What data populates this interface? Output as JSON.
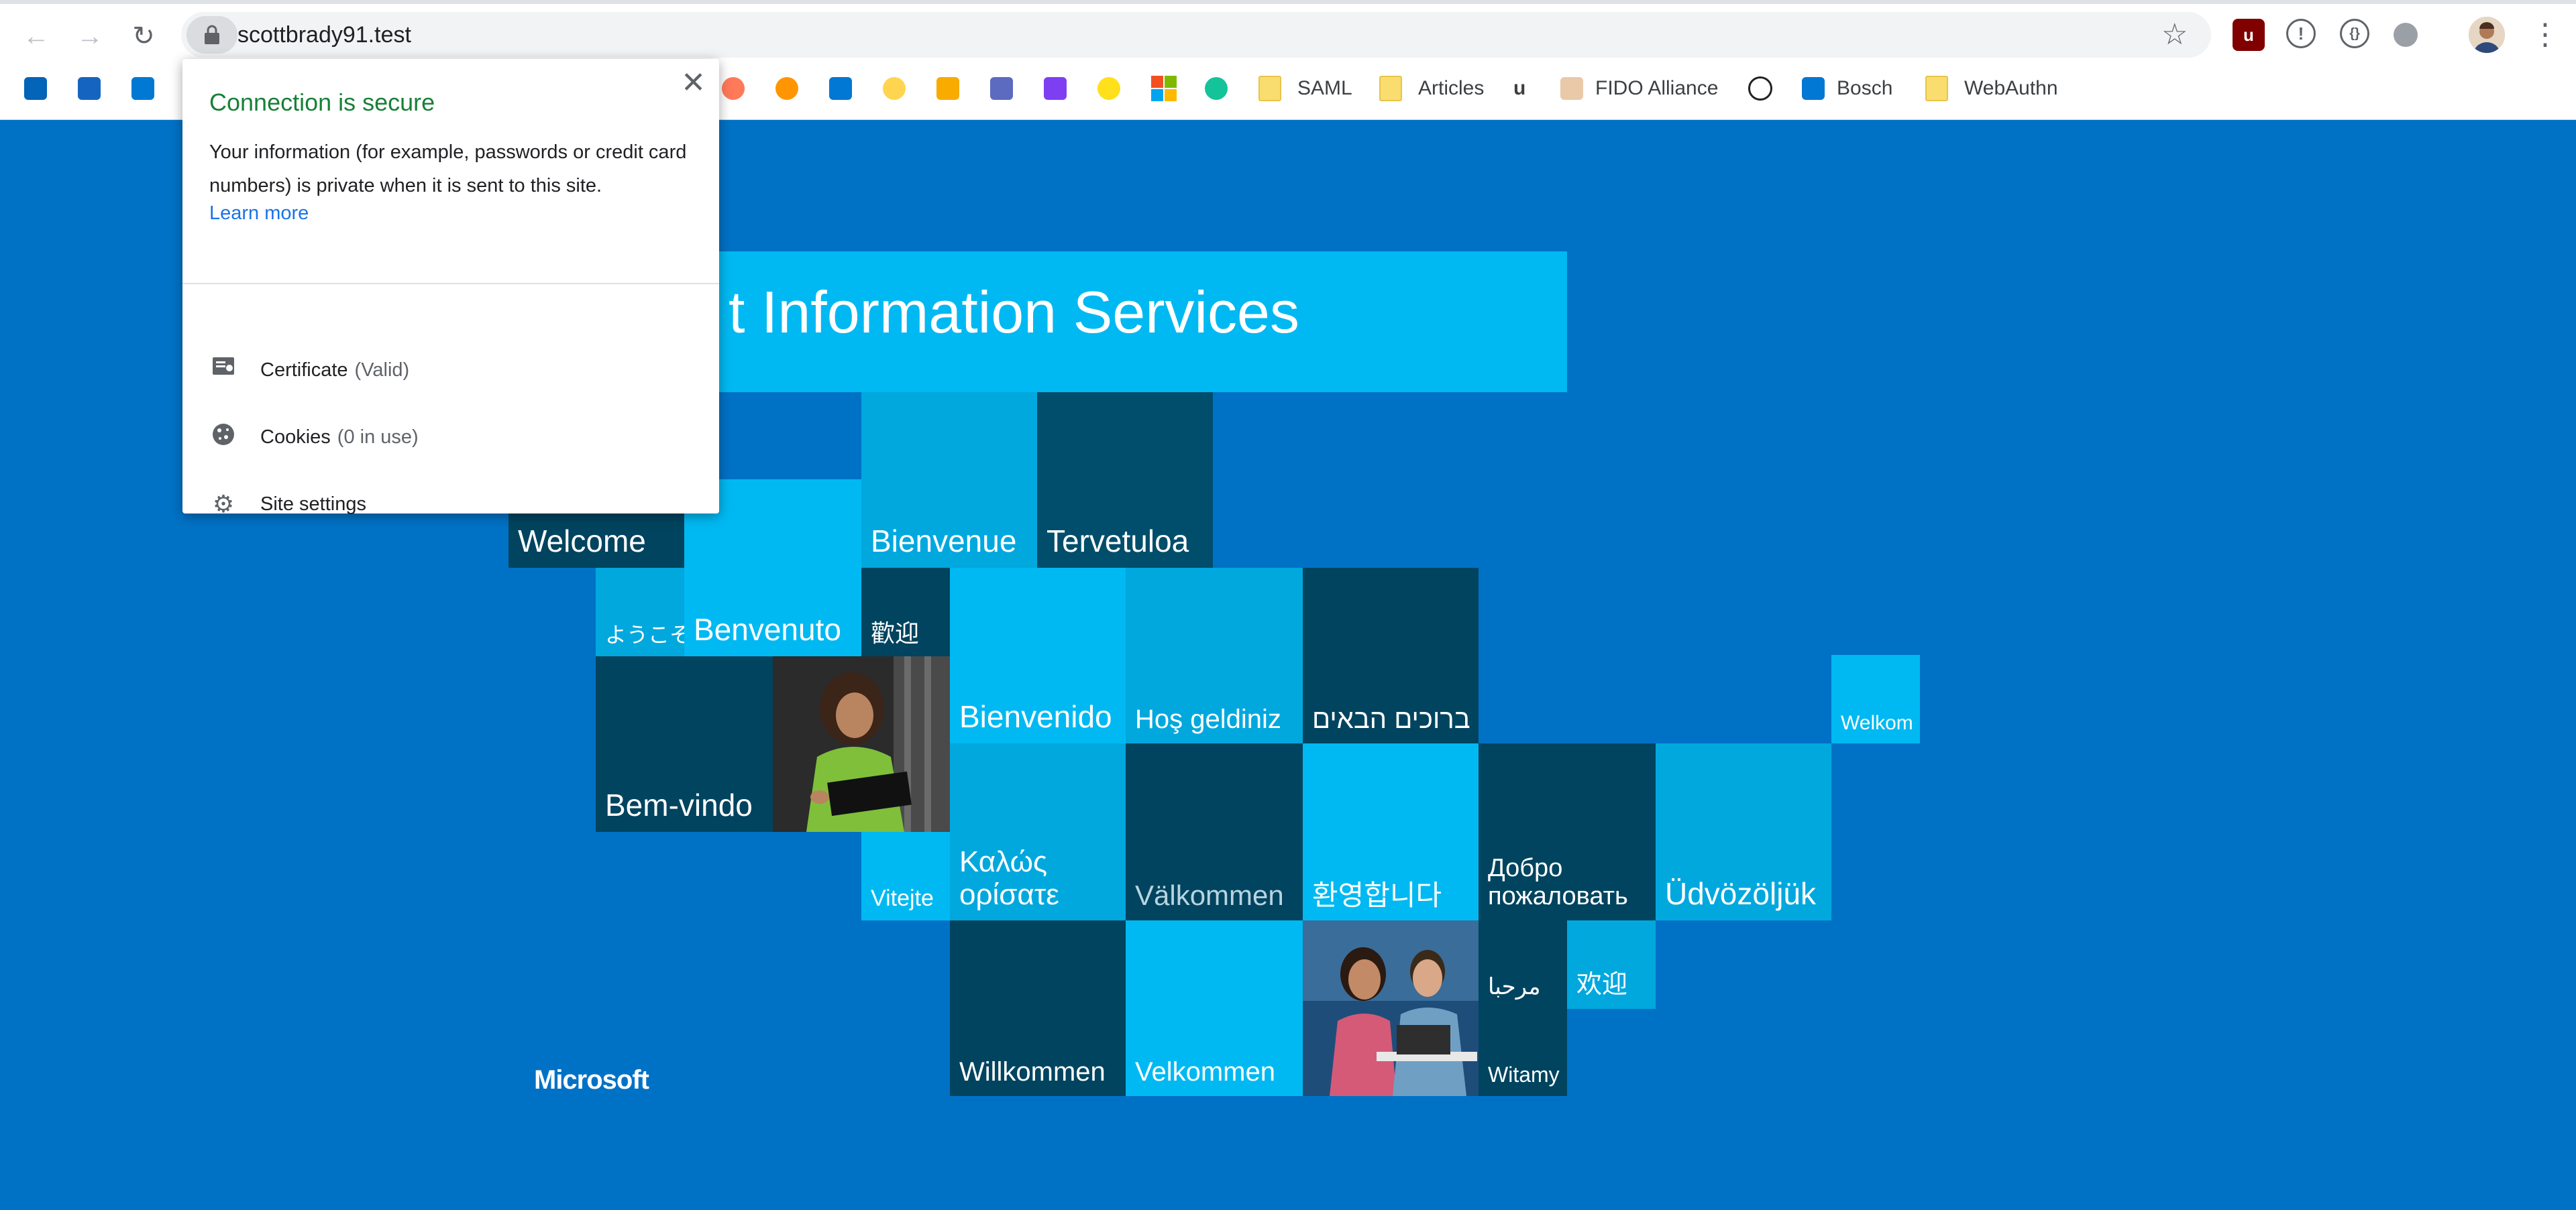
{
  "browser": {
    "url": "scottbrady91.test"
  },
  "bookmarks": [
    {
      "label": "SAML"
    },
    {
      "label": "Articles"
    },
    {
      "label": "FIDO Alliance"
    },
    {
      "label": "Bosch"
    },
    {
      "label": "WebAuthn"
    }
  ],
  "popup": {
    "title": "Connection is secure",
    "description": "Your information (for example, passwords or credit card numbers) is private when it is sent to this site.",
    "learn_more": "Learn more",
    "certificate_label": "Certificate",
    "certificate_status": "(Valid)",
    "cookies_label": "Cookies",
    "cookies_status": "(0 in use)",
    "site_settings_label": "Site settings"
  },
  "page": {
    "banner_text": "t Information Services",
    "brand": "Microsoft",
    "tiles": {
      "welcome": "Welcome",
      "bienvenue": "Bienvenue",
      "tervetuloa": "Tervetuloa",
      "youkoso": "ようこそ",
      "benvenuto": "Benvenuto",
      "kanying": "歡迎",
      "bienvenido": "Bienvenido",
      "hos_geldiniz": "Hoş geldiniz",
      "hebrew": "ברוכים הבאים",
      "welkom": "Welkom",
      "bem_vindo": "Bem-vindo",
      "vitejte": "Vitejte",
      "greek": "Καλώς ορίσατε",
      "valkommen": "Välkommen",
      "korean": "환영합니다",
      "russian": "Добро пожаловать",
      "udvozoljuk": "Üdvözöljük",
      "marhaba": "مرحبا",
      "huanying": "欢迎",
      "willkommen": "Willkommen",
      "velkommen": "Velkommen",
      "witamy": "Witamy"
    }
  }
}
